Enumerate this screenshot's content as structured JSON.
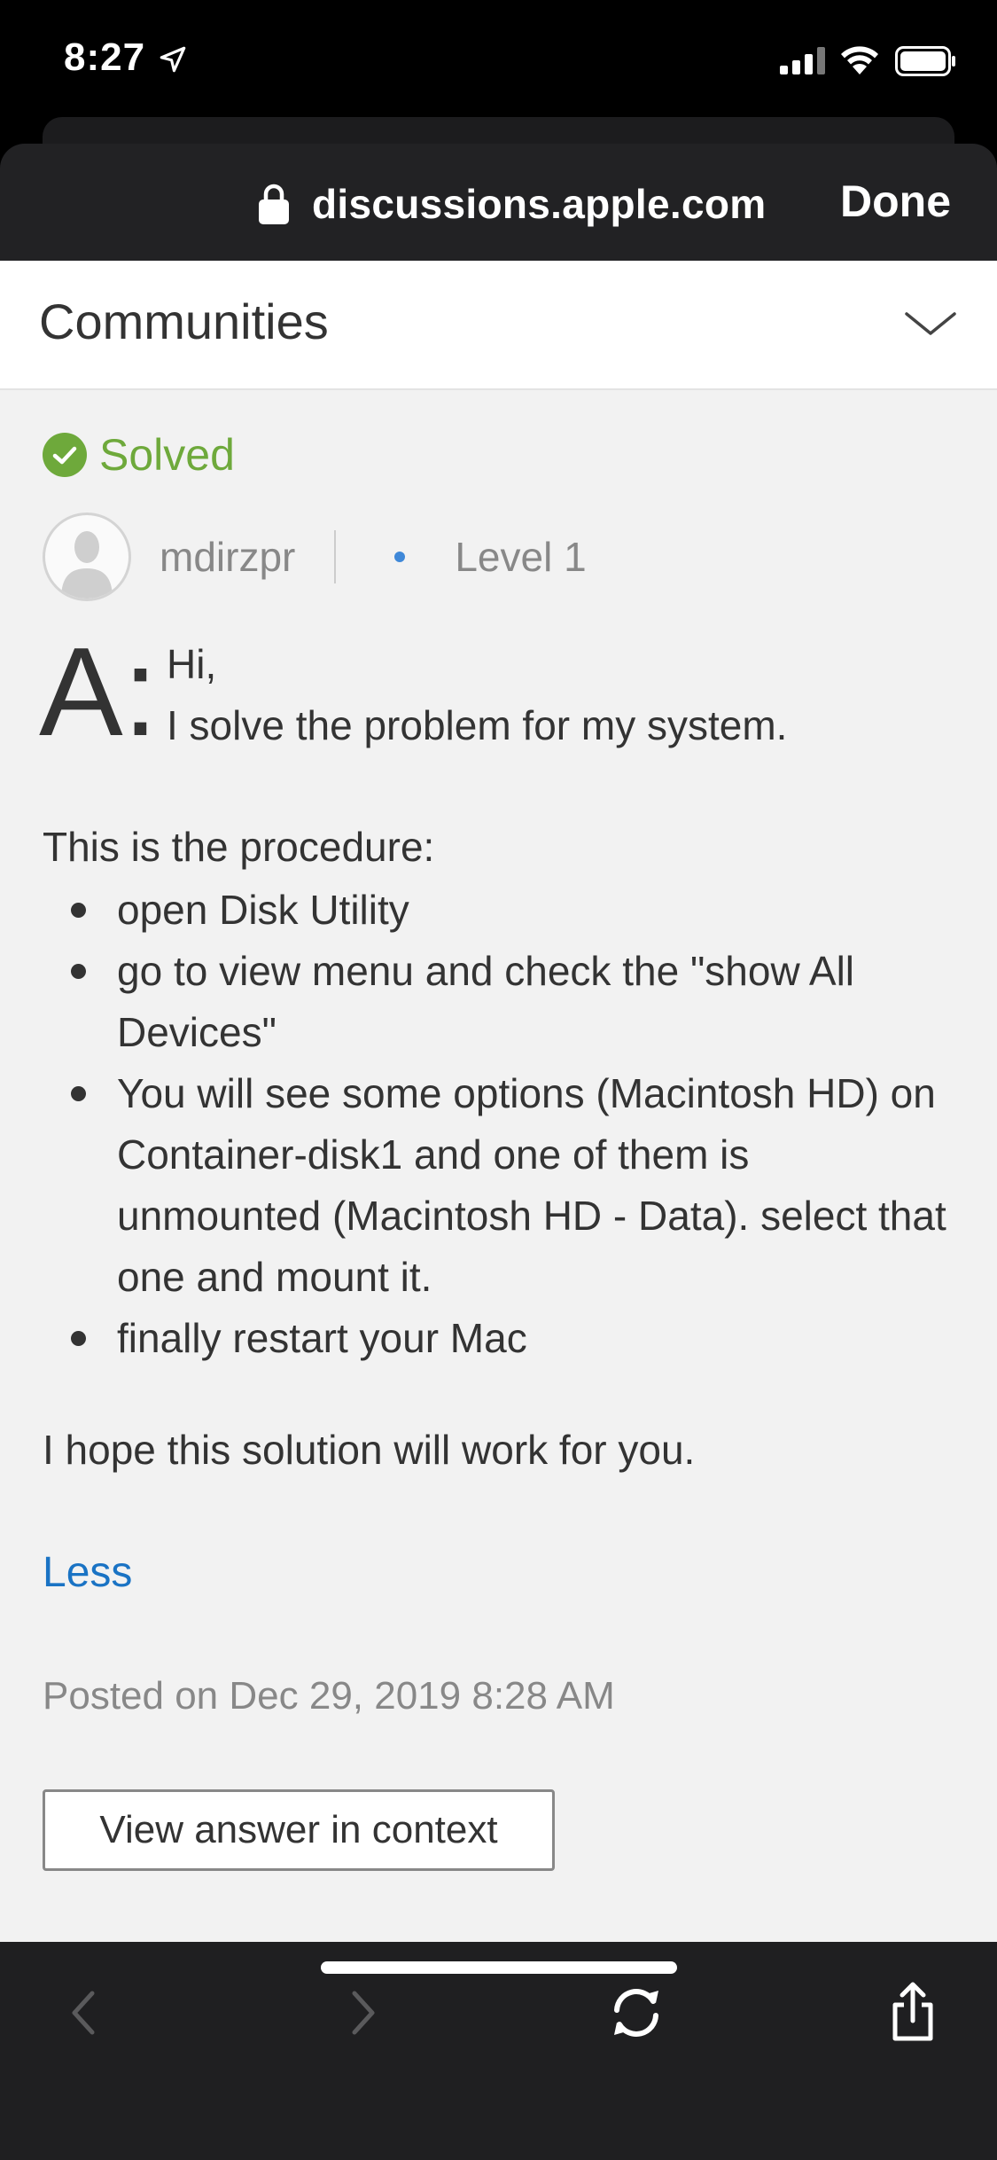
{
  "status_bar": {
    "time": "8:27"
  },
  "browser": {
    "url": "discussions.apple.com",
    "done_label": "Done"
  },
  "header": {
    "title": "Communities"
  },
  "post": {
    "solved_label": "Solved",
    "author": "mdirzpr",
    "level": "Level 1",
    "answer_marker": "A:",
    "intro_lines": [
      "Hi,",
      "I solve the problem for my system."
    ],
    "procedure_intro": "This is the procedure:",
    "steps": [
      "open Disk Utility",
      "go to view menu and check the \"show All Devices\"",
      "You will see some options (Macintosh HD) on Container-disk1 and one of them is unmounted (Macintosh HD - Data). select that one and mount it.",
      "finally restart your Mac"
    ],
    "closing": "I hope this solution will work for you.",
    "less_label": "Less",
    "posted": "Posted on Dec 29, 2019 8:28 AM",
    "view_answer_label": "View answer in context"
  },
  "toolbar": {
    "icons": [
      "back-icon",
      "forward-icon",
      "refresh-icon",
      "share-icon"
    ]
  },
  "colors": {
    "solved_green": "#6ea93b",
    "link_blue": "#1a73c4",
    "level_dot": "#3f88d8"
  }
}
